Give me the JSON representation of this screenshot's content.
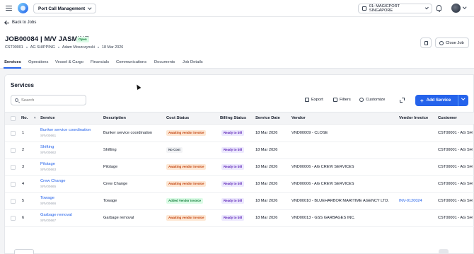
{
  "topbar": {
    "module": "Port Call Management",
    "port": "01: MAGICPORT SINGAPORE"
  },
  "header": {
    "back_label": "Back to Jobs",
    "job_title": "JOB00084 | M/V JASMINE",
    "status_badge": "Open",
    "meta": [
      "CST00001",
      "AG SHIPPING",
      "Adam Moszczynski",
      "18 Mar 2026"
    ],
    "close_job_label": "Close Job"
  },
  "tabs": [
    "Services",
    "Operations",
    "Vessel & Cargo",
    "Financials",
    "Communications",
    "Documents",
    "Job Details"
  ],
  "panel": {
    "title": "Services",
    "search_placeholder": "Search",
    "export_label": "Export",
    "filters_label": "Filters",
    "customize_label": "Customize",
    "add_label": "Add Service"
  },
  "columns": [
    "No.",
    "Service",
    "Description",
    "Cost Status",
    "Billing Status",
    "Service Date",
    "Vendor",
    "Vendor Invoice",
    "Customer"
  ],
  "rows": [
    {
      "no": "1",
      "service": "Bunker service coordination",
      "code": "SRV00661",
      "description": "Bunker service coordination",
      "cost_status": "Awaiting vendor invoice",
      "billing_status": "Ready to bill",
      "date": "18 Mar 2026",
      "vendor": "VND00009 - CLOSE",
      "vendor_invoice": "",
      "customer": "CST00001 - AG SH"
    },
    {
      "no": "2",
      "service": "Shifting",
      "code": "SRV00662",
      "description": "Shifting",
      "cost_status": "No Cost",
      "billing_status": "Ready to bill",
      "date": "18 Mar 2026",
      "vendor": "",
      "vendor_invoice": "",
      "customer": "CST00001 - AG SH"
    },
    {
      "no": "3",
      "service": "Pilotage",
      "code": "SRV00663",
      "description": "Pilotage",
      "cost_status": "Awaiting vendor invoice",
      "billing_status": "Ready to bill",
      "date": "18 Mar 2026",
      "vendor": "VND00006 - AG CREW SERVICES",
      "vendor_invoice": "",
      "customer": "CST00001 - AG SH"
    },
    {
      "no": "4",
      "service": "Crew Change",
      "code": "SRV00665",
      "description": "Crew Change",
      "cost_status": "Awaiting vendor invoice",
      "billing_status": "Ready to bill",
      "date": "18 Mar 2026",
      "vendor": "VND00006 - AG CREW SERVICES",
      "vendor_invoice": "",
      "customer": "CST00001 - AG SH"
    },
    {
      "no": "5",
      "service": "Towage",
      "code": "SRV00666",
      "description": "Towage",
      "cost_status": "Added Vendor Invoice",
      "billing_status": "Ready to bill",
      "date": "18 Mar 2026",
      "vendor": "VND00010 - BLUEHARBOR MARITIME AGENCY LTD.",
      "vendor_invoice": "INV-0120024",
      "customer": "CST00001 - AG SH"
    },
    {
      "no": "6",
      "service": "Garbage removal",
      "code": "SRV00667",
      "description": "Garbage removal",
      "cost_status": "Awaiting vendor invoice",
      "billing_status": "Ready to bill",
      "date": "18 Mar 2026",
      "vendor": "VND00013 - GSS GARBAGES INC.",
      "vendor_invoice": "",
      "customer": "CST00001 - AG SH"
    }
  ],
  "status_colors": {
    "Awaiting vendor invoice": {
      "bg": "#fde7d4",
      "fg": "#c2410c"
    },
    "No Cost": {
      "bg": "#f3f4f6",
      "fg": "#374151"
    },
    "Added Vendor Invoice": {
      "bg": "#dcfce7",
      "fg": "#15803d"
    },
    "Ready to bill": {
      "bg": "#ede9fe",
      "fg": "#5b21b6"
    }
  }
}
